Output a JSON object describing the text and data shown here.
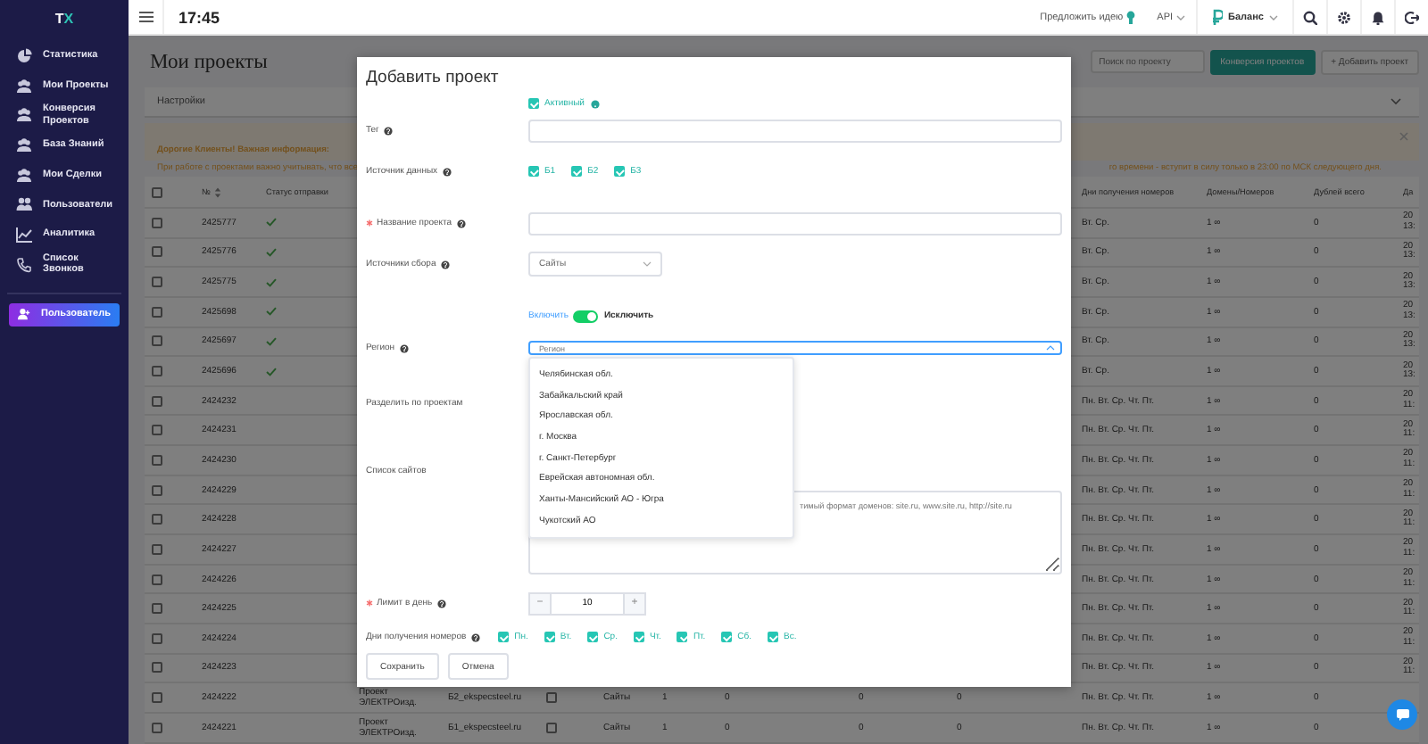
{
  "sidebar": {
    "logo": {
      "text": "T",
      "accent": "X"
    },
    "items": [
      {
        "label": "Статистика"
      },
      {
        "label": "Мои Проекты"
      },
      {
        "label": "Конверсия Проектов"
      },
      {
        "label": "База Знаний"
      },
      {
        "label": "Мои Сделки"
      },
      {
        "label": "Пользователи"
      },
      {
        "label": "Аналитика"
      },
      {
        "label": "Список Звонков"
      }
    ],
    "user_button": "Пользователь"
  },
  "topbar": {
    "time": "17:45",
    "idea": "Предложить идею",
    "api": "API",
    "balance": "Баланс"
  },
  "page": {
    "title": "Мои проекты",
    "search_placeholder": "Поиск по проекту",
    "buttons": [
      "Конверсия проектов",
      "+ Добавить проект"
    ],
    "settings": "Настройки",
    "notice": {
      "title": "Дорогие Клиенты! Важная информация:",
      "text_left": "При работе с проектами важно учитывать, что все",
      "text_right": "го времени - вступит в силу только в 23:00 по МСК следующего дня."
    }
  },
  "table": {
    "all_checked": false,
    "columns": {
      "id": "№",
      "status": "Статус отправки",
      "days": "Дни получения номеров",
      "domains": "Домены/Номеров",
      "dups": "Дублей всего",
      "date": "Да"
    },
    "rows": [
      {
        "checked": false,
        "id": "2425777",
        "sent": true,
        "days": "Вт. Ср.",
        "domains": "1 ∞",
        "dups": "0",
        "date": "20",
        "time": "13:"
      },
      {
        "checked": false,
        "id": "2425776",
        "sent": true,
        "days": "Вт. Ср.",
        "domains": "1 ∞",
        "dups": "0",
        "date": "20",
        "time": "13:"
      },
      {
        "checked": false,
        "id": "2425775",
        "sent": true,
        "days": "Вт. Ср.",
        "domains": "1 ∞",
        "dups": "0",
        "date": "20",
        "time": "13:"
      },
      {
        "checked": false,
        "id": "2425698",
        "sent": true,
        "days": "Вт. Ср.",
        "domains": "1 ∞",
        "dups": "0",
        "date": "20",
        "time": "13:"
      },
      {
        "checked": false,
        "id": "2425697",
        "sent": true,
        "days": "Вт. Ср.",
        "domains": "1 ∞",
        "dups": "0",
        "date": "20",
        "time": "13:"
      },
      {
        "checked": false,
        "id": "2425696",
        "sent": true,
        "days": "Вт. Ср.",
        "domains": "1 ∞",
        "dups": "0",
        "date": "20",
        "time": "13:"
      },
      {
        "checked": false,
        "id": "2424232",
        "sent": false,
        "days": "Пн. Вт. Ср. Чт. Пт.",
        "domains": "1 ∞",
        "dups": "0",
        "date": "20",
        "time": "11:"
      },
      {
        "checked": false,
        "id": "2424231",
        "sent": false,
        "days": "Пн. Вт. Ср. Чт. Пт.",
        "domains": "1 ∞",
        "dups": "0",
        "date": "20",
        "time": "11:"
      },
      {
        "checked": false,
        "id": "2424230",
        "sent": false,
        "days": "Пн. Вт. Ср. Чт. Пт.",
        "domains": "1 ∞",
        "dups": "0",
        "date": "20",
        "time": "11:"
      },
      {
        "checked": false,
        "id": "2424229",
        "sent": false,
        "days": "Пн. Вт. Ср. Чт. Пт.",
        "domains": "1 ∞",
        "dups": "0",
        "date": "20",
        "time": "11:"
      },
      {
        "checked": false,
        "id": "2424228",
        "sent": false,
        "days": "Пн. Вт. Ср. Чт. Пт.",
        "domains": "1 ∞",
        "dups": "0",
        "date": "20",
        "time": "11:"
      },
      {
        "checked": false,
        "id": "2424227",
        "sent": false,
        "days": "Пн. Вт. Ср. Чт. Пт.",
        "domains": "1 ∞",
        "dups": "0",
        "date": "20",
        "time": "11:"
      },
      {
        "checked": false,
        "id": "2424226",
        "sent": false,
        "days": "Пн. Вт. Ср. Чт. Пт.",
        "domains": "1 ∞",
        "dups": "0",
        "date": "20",
        "time": "11:"
      },
      {
        "checked": false,
        "id": "2424225",
        "sent": false,
        "days": "Пн. Вт. Ср. Чт. Пт.",
        "domains": "1 ∞",
        "dups": "0",
        "date": "20",
        "time": "11:"
      },
      {
        "checked": false,
        "id": "2424224",
        "sent": false,
        "days": "Пн. Вт. Ср. Чт. Пт.",
        "domains": "1 ∞",
        "dups": "0",
        "date": "20",
        "time": "11:"
      },
      {
        "checked": false,
        "id": "2424223",
        "sent": false,
        "days": "Пн. Вт. Ср. Чт. Пт.",
        "domains": "1 ∞",
        "dups": "0",
        "date": "20",
        "time": "11:"
      },
      {
        "checked": false,
        "id": "2424222",
        "sent": false,
        "project": "Проект ЭЛЕКТРОизд.",
        "site": "Б2_ekspecsteel.ru",
        "flag": false,
        "source": "Сайты",
        "column_8": "1",
        "column_9": "0",
        "column_10": "0",
        "column_11": "0",
        "days": "Пн. Вт. Ср. Чт. Пт.",
        "domains": "1 ∞",
        "dups": "0"
      },
      {
        "checked": false,
        "id": "2424221",
        "sent": false,
        "project": "Проект ЭЛЕКТРОизд.",
        "site": "Б1_ekspecsteel.ru",
        "flag": false,
        "source": "Сайты",
        "column_8": "1",
        "column_9": "0",
        "column_10": "0",
        "column_11": "0",
        "days": "Пн. Вт. Ср. Чт. Пт.",
        "domains": "1 ∞",
        "dups": "0"
      }
    ]
  },
  "modal": {
    "title": "Добавить проект",
    "active": {
      "label": "Активный",
      "checked": true,
      "help": true
    },
    "fields": [
      {
        "kind": "input",
        "label": "Тег",
        "required": false,
        "help": true
      },
      {
        "kind": "checks",
        "label": "Источник данных",
        "required": false,
        "help": true,
        "options": [
          {
            "label": "Б1",
            "checked": true
          },
          {
            "label": "Б2",
            "checked": true
          },
          {
            "label": "Б3",
            "checked": true
          }
        ]
      },
      {
        "kind": "input",
        "label": "Название проекта",
        "required": true,
        "help": true
      },
      {
        "kind": "select",
        "label": "Источники сбора",
        "required": false,
        "help": true,
        "value": "Сайты"
      },
      {
        "kind": "switch",
        "on_label": "Включить",
        "off_label": "Исключить",
        "on": true
      },
      {
        "kind": "combo",
        "label": "Регион",
        "required": false,
        "help": true,
        "placeholder": "Регион",
        "expanded": true,
        "options": [
          "Челябинская обл.",
          "Забайкальский край",
          "Ярославская обл.",
          "г. Москва",
          "г. Санкт-Петербург",
          "Еврейская автономная обл.",
          "Ханты-Мансийский АО - Югра",
          "Чукотский АО"
        ]
      },
      {
        "kind": "label",
        "label": "Разделить по проектам",
        "required": false,
        "help": false
      },
      {
        "kind": "textarea",
        "label": "Список сайтов",
        "required": false,
        "help": false,
        "placeholder": "тимый формат доменов: site.ru, www.site.ru, http://site.ru"
      },
      {
        "kind": "stepper",
        "label": "Лимит в день",
        "required": true,
        "help": true,
        "minus": "−",
        "value": "10",
        "plus": "+"
      },
      {
        "kind": "checks",
        "label": "Дни получения номеров",
        "required": false,
        "help": true,
        "options": [
          {
            "label": "Пн.",
            "checked": true
          },
          {
            "label": "Вт.",
            "checked": true
          },
          {
            "label": "Ср.",
            "checked": true
          },
          {
            "label": "Чт.",
            "checked": true
          },
          {
            "label": "Пт.",
            "checked": true
          },
          {
            "label": "Сб.",
            "checked": true
          },
          {
            "label": "Вс.",
            "checked": true
          }
        ]
      }
    ],
    "buttons": [
      "Сохранить",
      "Отмена"
    ]
  }
}
